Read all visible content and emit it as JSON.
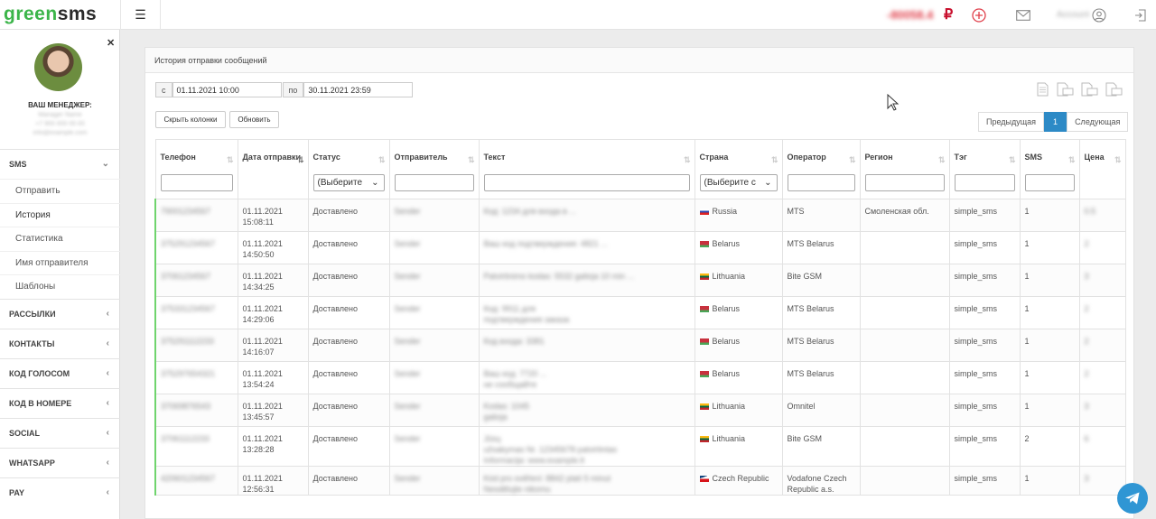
{
  "logo": {
    "green": "green",
    "sms": "sms"
  },
  "topbar": {
    "balance": "-80058.4",
    "currency_symbol": "₽",
    "username": "Account"
  },
  "sidebar": {
    "manager_title": "ВАШ МЕНЕДЖЕР:",
    "manager_lines": [
      "Manager Name",
      "+7 900 000 00 00",
      "info@example.com"
    ],
    "sections": [
      {
        "label": "SMS",
        "expanded": true,
        "items": [
          "Отправить",
          "История",
          "Статистика",
          "Имя отправителя",
          "Шаблоны"
        ]
      },
      {
        "label": "РАССЫЛКИ"
      },
      {
        "label": "КОНТАКТЫ"
      },
      {
        "label": "КОД ГОЛОСОМ"
      },
      {
        "label": "КОД В НОМЕРЕ"
      },
      {
        "label": "SOCIAL"
      },
      {
        "label": "WHATSAPP"
      },
      {
        "label": "PAY"
      }
    ]
  },
  "panel": {
    "title": "История отправки сообщений",
    "from_label": "с",
    "from_value": "01.11.2021 10:00",
    "to_label": "по",
    "to_value": "30.11.2021 23:59",
    "hide_columns": "Скрыть колонки",
    "refresh": "Обновить",
    "pager": {
      "prev": "Предыдущая",
      "current": "1",
      "next": "Следующая"
    }
  },
  "table": {
    "columns": [
      "Телефон",
      "Дата отправки",
      "Статус",
      "Отправитель",
      "Текст",
      "Страна",
      "Оператор",
      "Регион",
      "Тэг",
      "SMS",
      "Цена"
    ],
    "select_placeholder": "(Выберите",
    "select_placeholder_country": "(Выберите с",
    "rows": [
      {
        "phone": "79001234567",
        "date": "01.11.2021",
        "time": "15:08:11",
        "status": "Доставлено",
        "sender": "Sender",
        "text": [
          "Код: 1234 для входа в ..."
        ],
        "country": "Russia",
        "flag": "ru",
        "operator": "MTS",
        "region": "Смоленская обл.",
        "tag": "simple_sms",
        "sms": "1",
        "price": "0.5"
      },
      {
        "phone": "375291234567",
        "date": "01.11.2021",
        "time": "14:50:50",
        "status": "Доставлено",
        "sender": "Sender",
        "text": [
          "Ваш код подтверждения: 4821 ..."
        ],
        "country": "Belarus",
        "flag": "by",
        "operator": "MTS Belarus",
        "region": "",
        "tag": "simple_sms",
        "sms": "1",
        "price": "2"
      },
      {
        "phone": "37061234567",
        "date": "01.11.2021",
        "time": "14:34:25",
        "status": "Доставлено",
        "sender": "Sender",
        "text": [
          "Patvirtinimo kodas: 5532 galioja 10 min ..."
        ],
        "country": "Lithuania",
        "flag": "lt",
        "operator": "Bite GSM",
        "region": "",
        "tag": "simple_sms",
        "sms": "1",
        "price": "3"
      },
      {
        "phone": "375331234567",
        "date": "01.11.2021",
        "time": "14:29:06",
        "status": "Доставлено",
        "sender": "Sender",
        "text": [
          "Код: 9911 для",
          "подтверждения заказа"
        ],
        "country": "Belarus",
        "flag": "by",
        "operator": "MTS Belarus",
        "region": "",
        "tag": "simple_sms",
        "sms": "1",
        "price": "2"
      },
      {
        "phone": "375291112233",
        "date": "01.11.2021",
        "time": "14:16:07",
        "status": "Доставлено",
        "sender": "Sender",
        "text": [
          "Код входа: 3381"
        ],
        "country": "Belarus",
        "flag": "by",
        "operator": "MTS Belarus",
        "region": "",
        "tag": "simple_sms",
        "sms": "1",
        "price": "2"
      },
      {
        "phone": "375297654321",
        "date": "01.11.2021",
        "time": "13:54:24",
        "status": "Доставлено",
        "sender": "Sender",
        "text": [
          "Ваш код: 7720 ...",
          "не сообщайте"
        ],
        "country": "Belarus",
        "flag": "by",
        "operator": "MTS Belarus",
        "region": "",
        "tag": "simple_sms",
        "sms": "1",
        "price": "2"
      },
      {
        "phone": "37069876543",
        "date": "01.11.2021",
        "time": "13:45:57",
        "status": "Доставлено",
        "sender": "Sender",
        "text": [
          "Kodas: 1045",
          "galioja"
        ],
        "country": "Lithuania",
        "flag": "lt",
        "operator": "Omnitel",
        "region": "",
        "tag": "simple_sms",
        "sms": "1",
        "price": "3"
      },
      {
        "phone": "37061112233",
        "date": "01.11.2021",
        "time": "13:28:28",
        "status": "Доставлено",
        "sender": "Sender",
        "text": [
          "Jūsų",
          "užsakymas Nr. 12345678 patvirtintas",
          "",
          "Informacija: www.example.lt"
        ],
        "country": "Lithuania",
        "flag": "lt",
        "operator": "Bite GSM",
        "region": "",
        "tag": "simple_sms",
        "sms": "2",
        "price": "6"
      },
      {
        "phone": "420601234567",
        "date": "01.11.2021",
        "time": "12:56:31",
        "status": "Доставлено",
        "sender": "Sender",
        "text": [
          "Kód pro ověření: 8842 platí 5 minut",
          "Nesdělujte nikomu"
        ],
        "country": "Czech Republic",
        "flag": "cz",
        "operator": "Vodafone Czech Republic a.s.",
        "region": "",
        "tag": "simple_sms",
        "sms": "1",
        "price": "3"
      }
    ]
  },
  "colors": {
    "brand_green": "#3cb54a",
    "accent_blue": "#2d8ac6",
    "row_marker": "#6fd46d"
  }
}
